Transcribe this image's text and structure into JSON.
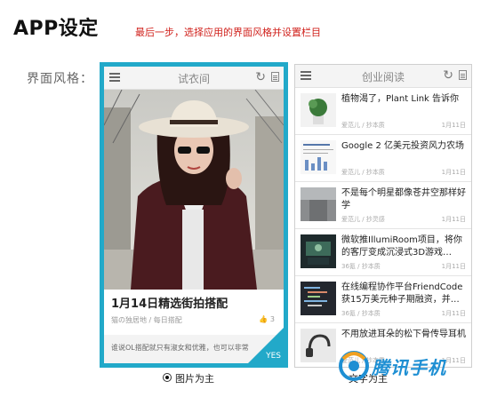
{
  "page": {
    "title": "APP设定",
    "hint": "最后一步，选择应用的界面风格并设置栏目",
    "style_label": "界面风格："
  },
  "theme": {
    "accent": "#22a9c9",
    "hint_color": "#d0201b"
  },
  "phone1": {
    "title": "试衣间",
    "icons": [
      "menu-icon",
      "refresh-icon",
      "document-icon"
    ],
    "article_title": "1月14日精选街拍搭配",
    "article_meta": "猫の独居地 / 每日搭配",
    "likes": "3",
    "excerpt": "谁说OL搭配就只有淑女和优雅，也可以非常",
    "badge": "YES"
  },
  "phone2": {
    "title": "创业阅读",
    "items": [
      {
        "title": "植物渴了，Plant Link 告诉你",
        "source": "爱范儿 / 抄本质",
        "date": "1月11日"
      },
      {
        "title": "Google 2 亿美元投资风力农场",
        "source": "爱范儿 / 抄本质",
        "date": "1月11日"
      },
      {
        "title": "不是每个明星都像苍井空那样好学",
        "source": "爱范儿 / 抄灵感",
        "date": "1月11日"
      },
      {
        "title": "微软推IllumiRoom项目，将你的客厅变成沉浸式3D游戏…",
        "source": "36氪 / 抄本质",
        "date": "1月11日"
      },
      {
        "title": "在线编程协作平台FriendCode获15万美元种子期融资，并…",
        "source": "36氪 / 抄本质",
        "date": "1月11日"
      },
      {
        "title": "不用放进耳朵的松下骨传导耳机",
        "source": "爱范儿 / 抄本质",
        "date": "1月11日"
      }
    ]
  },
  "options": {
    "selected": "图片为主",
    "other": "文字为主"
  },
  "watermark": {
    "text": "腾讯手机"
  }
}
